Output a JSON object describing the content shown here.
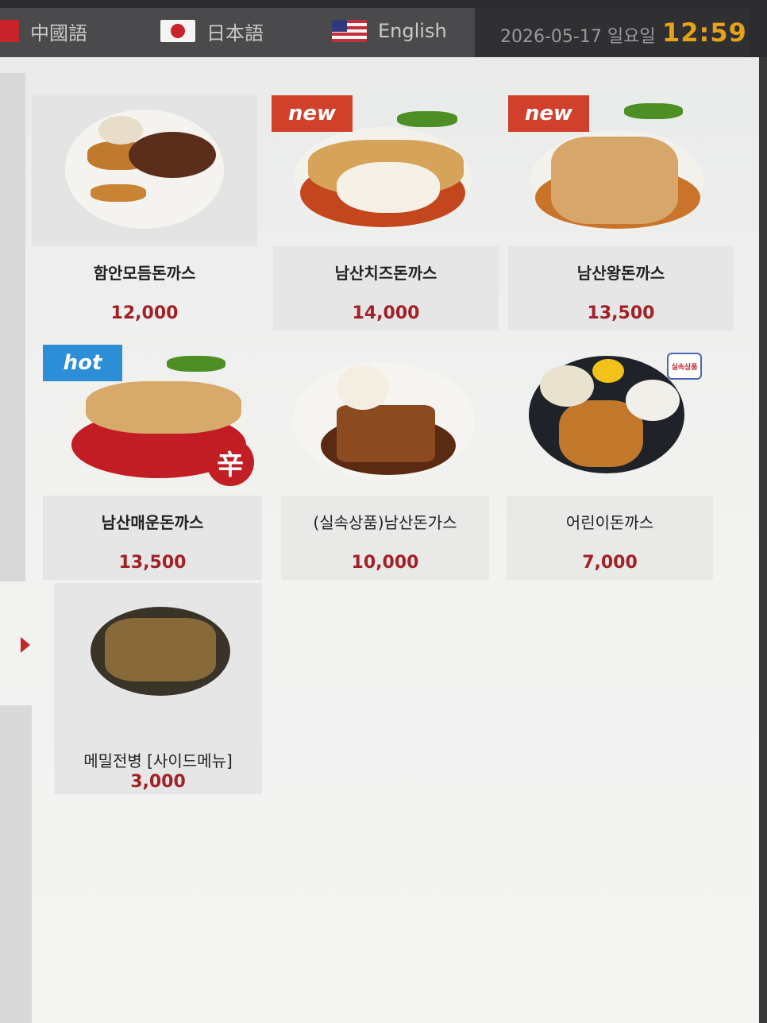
{
  "languages": [
    {
      "label": "中國語",
      "icon": "china-flag-icon"
    },
    {
      "label": "日本語",
      "icon": "japan-flag-icon"
    },
    {
      "label": "English",
      "icon": "us-flag-icon"
    }
  ],
  "status": {
    "date": "2026-05-17 일요일",
    "time": "12:59"
  },
  "menu": [
    {
      "name": "함안모듬돈까스",
      "price": "12,000",
      "badge": ""
    },
    {
      "name": "남산치즈돈까스",
      "price": "14,000",
      "badge": "new"
    },
    {
      "name": "남산왕돈까스",
      "price": "13,500",
      "badge": "new"
    },
    {
      "name": "남산매운돈까스",
      "price": "13,500",
      "badge": "hot",
      "spicy_mark": "辛"
    },
    {
      "name": "(실속상품)남산돈가스",
      "price": "10,000",
      "badge": ""
    },
    {
      "name": "어린이돈까스",
      "price": "7,000",
      "badge": "",
      "sticker": "실속상품"
    },
    {
      "name": "메밀전병 [사이드메뉴]",
      "price": "3,000",
      "badge": ""
    }
  ],
  "colors": {
    "accent_clock": "#e7a21c",
    "price": "#a12127",
    "badge_new": "#d1402a",
    "badge_hot": "#2c8ed6"
  }
}
